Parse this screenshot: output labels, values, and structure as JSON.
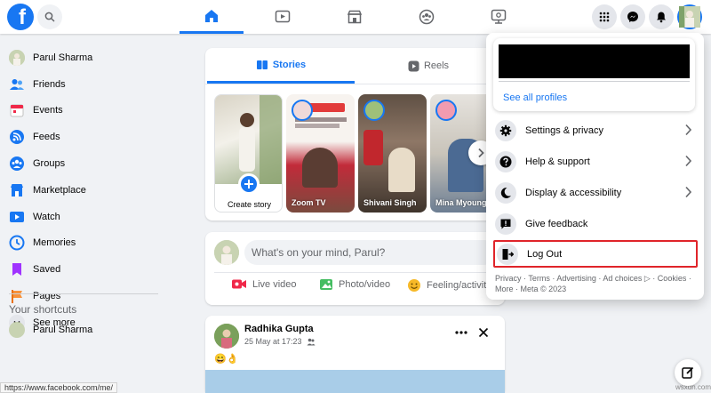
{
  "app": {
    "logo_letter": "f"
  },
  "sidebar": {
    "items": [
      {
        "label": "Parul Sharma",
        "icon": "avatar"
      },
      {
        "label": "Friends",
        "icon": "friends-icon"
      },
      {
        "label": "Events",
        "icon": "calendar-icon"
      },
      {
        "label": "Feeds",
        "icon": "feeds-icon"
      },
      {
        "label": "Groups",
        "icon": "groups-icon"
      },
      {
        "label": "Marketplace",
        "icon": "marketplace-icon"
      },
      {
        "label": "Watch",
        "icon": "watch-icon"
      },
      {
        "label": "Memories",
        "icon": "memories-icon"
      },
      {
        "label": "Saved",
        "icon": "bookmark-icon"
      },
      {
        "label": "Pages",
        "icon": "flag-icon"
      },
      {
        "label": "See more",
        "icon": "chevron-down-icon"
      }
    ],
    "shortcuts_title": "Your shortcuts",
    "shortcut_label": "Parul Sharma"
  },
  "stories": {
    "tab_stories": "Stories",
    "tab_reels": "Reels",
    "create_label": "Create story",
    "items": [
      {
        "name": "Zoom TV"
      },
      {
        "name": "Shivani Singh"
      },
      {
        "name": "Mina Myoung"
      }
    ]
  },
  "composer": {
    "placeholder": "What's on your mind, Parul?",
    "live_label": "Live video",
    "photo_label": "Photo/video",
    "feeling_label": "Feeling/activity"
  },
  "post": {
    "author": "Radhika Gupta",
    "time": "25 May at 17:23",
    "content": "😄👌"
  },
  "menu": {
    "see_all_profiles": "See all profiles",
    "items": [
      {
        "label": "Settings & privacy"
      },
      {
        "label": "Help & support"
      },
      {
        "label": "Display & accessibility"
      },
      {
        "label": "Give feedback"
      },
      {
        "label": "Log Out"
      }
    ],
    "footer": "Privacy · Terms · Advertising · Ad choices ▷ · Cookies · More · Meta © 2023"
  },
  "status_url": "https://www.facebook.com/me/",
  "watermark": "wsxdn.com",
  "colors": {
    "brand": "#1877f2",
    "highlight": "#e0242a"
  }
}
